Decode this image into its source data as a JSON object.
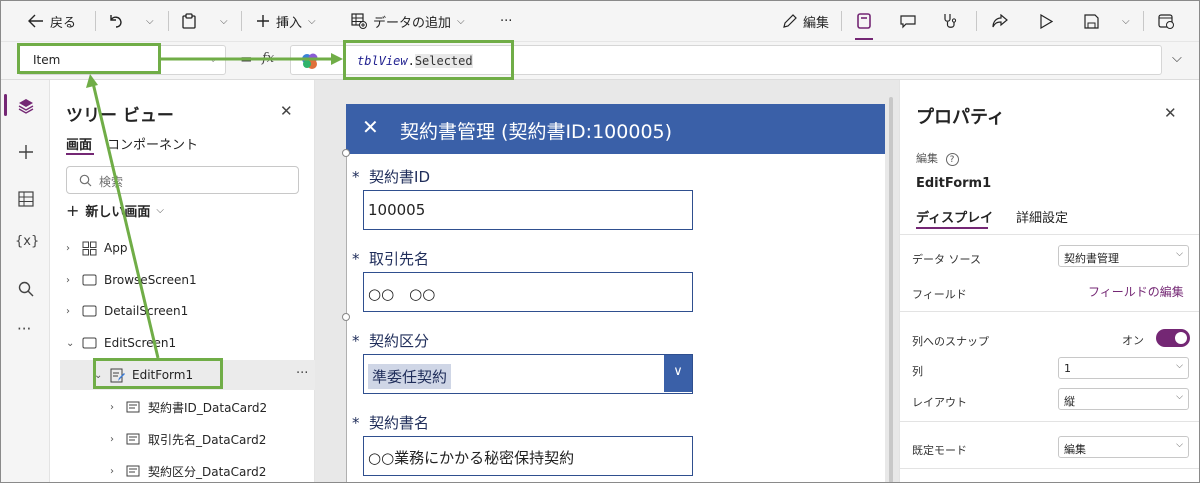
{
  "toolbar": {
    "back_label": "戻る",
    "insert_label": "挿入",
    "add_data_label": "データの追加",
    "more_label": "···",
    "edit_label": "編集"
  },
  "formula_bar": {
    "property": "Item",
    "equals": "=",
    "fx": "fx",
    "formula_part1": "tblView",
    "formula_dot": ".",
    "formula_part2": "Selected"
  },
  "tree_view": {
    "title": "ツリー ビュー",
    "tabs": [
      "画面",
      "コンポーネント"
    ],
    "search_placeholder": "検索",
    "new_screen_label": "新しい画面",
    "nodes": [
      {
        "label": "App"
      },
      {
        "label": "BrowseScreen1"
      },
      {
        "label": "DetailScreen1"
      },
      {
        "label": "EditScreen1"
      },
      {
        "label": "EditForm1"
      },
      {
        "label": "契約書ID_DataCard2"
      },
      {
        "label": "取引先名_DataCard2"
      },
      {
        "label": "契約区分_DataCard2"
      }
    ],
    "more_label": "···"
  },
  "form": {
    "header_title": "契約書管理 (契約書ID:100005)",
    "close_glyph": "✕",
    "required_mark": "*",
    "fields": [
      {
        "label": "契約書ID",
        "value": "100005"
      },
      {
        "label": "取引先名",
        "value": "○○　○○"
      },
      {
        "label": "契約区分",
        "value": "準委任契約"
      },
      {
        "label": "契約書名",
        "value": "○○業務にかかる秘密保持契約"
      }
    ]
  },
  "properties": {
    "title": "プロパティ",
    "edit_label": "編集",
    "control_name": "EditForm1",
    "tabs": [
      "ディスプレイ",
      "詳細設定"
    ],
    "data_source_label": "データ ソース",
    "data_source_value": "契約書管理",
    "fields_label": "フィールド",
    "fields_link": "フィールドの編集",
    "snap_label": "列へのスナップ",
    "snap_value": "オン",
    "snap_on": true,
    "columns_label": "列",
    "columns_value": "1",
    "layout_label": "レイアウト",
    "layout_value": "縦",
    "default_mode_label": "既定モード",
    "default_mode_value": "編集"
  },
  "colors": {
    "accent": "#742774",
    "form_header": "#3a60a8",
    "highlight": "#70ad47"
  }
}
